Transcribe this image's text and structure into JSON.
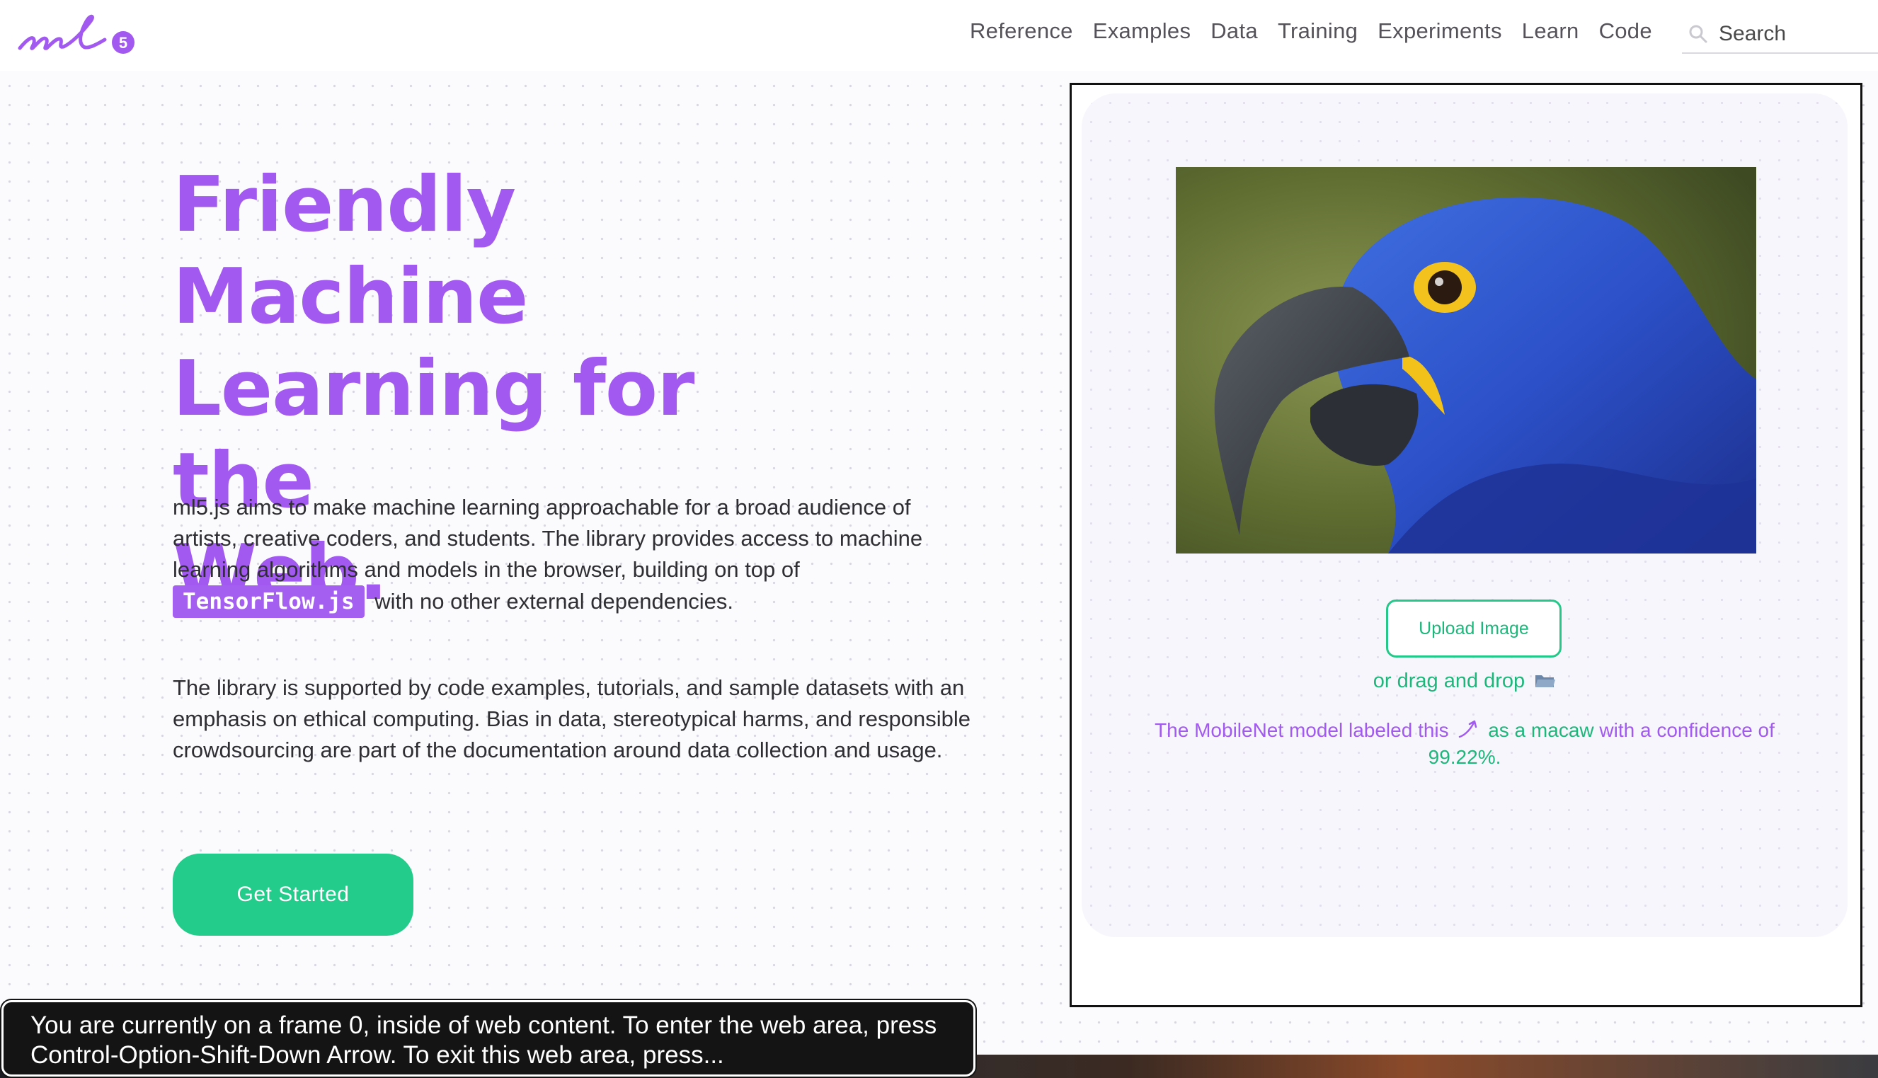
{
  "header": {
    "logo_text": "ml5",
    "nav": [
      "Reference",
      "Examples",
      "Data",
      "Training",
      "Experiments",
      "Learn",
      "Code"
    ],
    "search_placeholder": "Search"
  },
  "hero": {
    "title_lines": [
      "Friendly Machine",
      "Learning for the",
      "Web."
    ],
    "para1_text": "ml5.js aims to make machine learning approachable for a broad audience of artists, creative coders, and students. The library provides access to machine learning algorithms and models in the browser, building on top of",
    "para1_code": "TensorFlow.js",
    "para1_tail": "with no other external dependencies.",
    "para2": "The library is supported by code examples, tutorials, and sample datasets with an emphasis on ethical computing. Bias in data, stereotypical harms, and responsible crowdsourcing are part of the documentation around data collection and usage.",
    "cta_label": "Get Started"
  },
  "demo": {
    "upload_label": "Upload Image",
    "drag_text": "or drag and drop",
    "result_prefix": "The MobileNet model labeled this",
    "result_middle": "as a",
    "label": "macaw",
    "result_suffix": "with a confidence of",
    "confidence": "99.22%",
    "colors": {
      "purple": "#a259f0",
      "green": "#1db77b"
    }
  },
  "voiceover": {
    "text": "You are currently on a frame 0, inside of web content. To enter the web area, press Control-Option-Shift-Down Arrow.  To exit this web area, press..."
  }
}
